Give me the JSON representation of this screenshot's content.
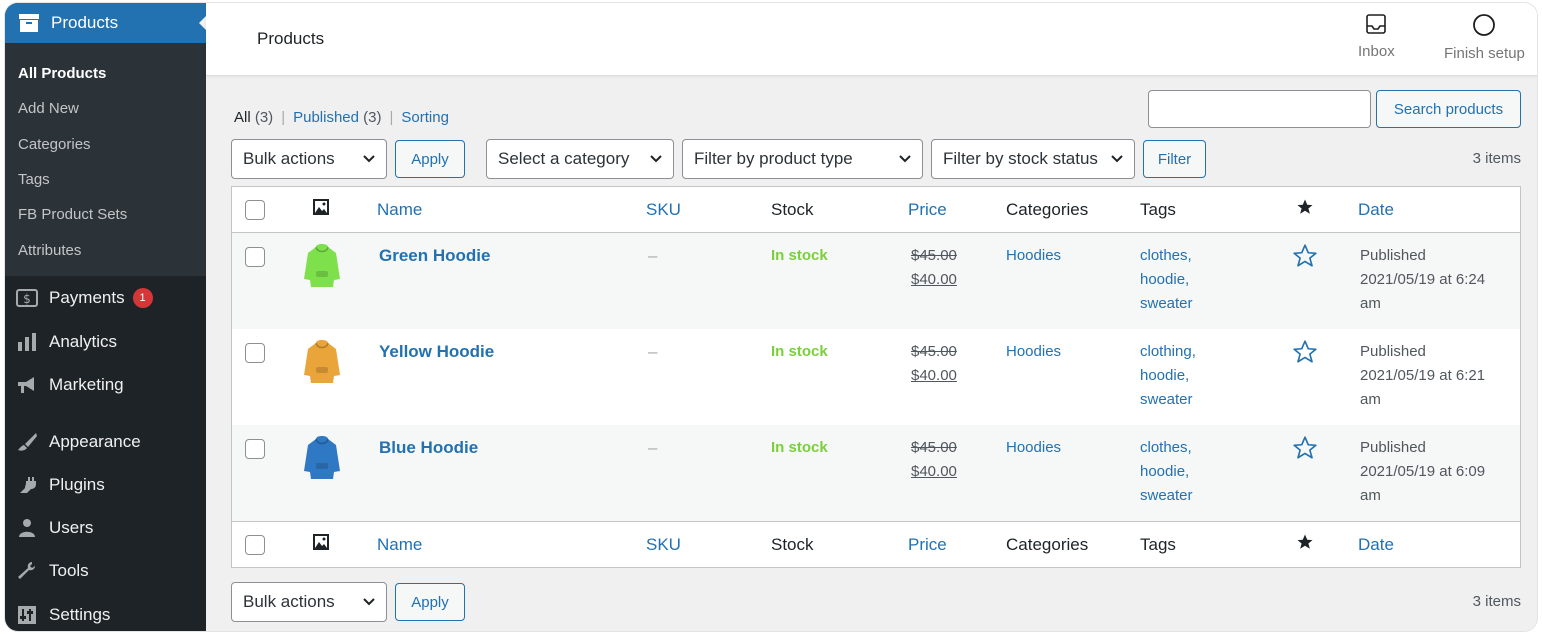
{
  "sidebar": {
    "active": {
      "label": "Products",
      "icon": "archive-icon"
    },
    "submenu": [
      {
        "label": "All Products",
        "current": true
      },
      {
        "label": "Add New"
      },
      {
        "label": "Categories"
      },
      {
        "label": "Tags"
      },
      {
        "label": "FB Product Sets"
      },
      {
        "label": "Attributes"
      }
    ],
    "menu": [
      {
        "label": "Payments",
        "icon": "dollar-icon",
        "badge": "1"
      },
      {
        "label": "Analytics",
        "icon": "bar-chart-icon"
      },
      {
        "label": "Marketing",
        "icon": "megaphone-icon"
      },
      {
        "label": "Appearance",
        "icon": "brush-icon"
      },
      {
        "label": "Plugins",
        "icon": "plug-icon"
      },
      {
        "label": "Users",
        "icon": "user-icon"
      },
      {
        "label": "Tools",
        "icon": "wrench-icon"
      },
      {
        "label": "Settings",
        "icon": "settings-icon"
      }
    ]
  },
  "header": {
    "title": "Products",
    "inbox_label": "Inbox",
    "finish_setup_label": "Finish setup"
  },
  "views": {
    "all": "All",
    "all_count": "(3)",
    "published": "Published",
    "published_count": "(3)",
    "sorting": "Sorting"
  },
  "search": {
    "value": "",
    "button": "Search products"
  },
  "filters": {
    "bulk_actions": "Bulk actions",
    "apply": "Apply",
    "category": "Select a category",
    "product_type": "Filter by product type",
    "stock_status": "Filter by stock status",
    "filter_button": "Filter",
    "items_count": "3 items"
  },
  "table": {
    "columns": {
      "name": "Name",
      "sku": "SKU",
      "stock": "Stock",
      "price": "Price",
      "categories": "Categories",
      "tags": "Tags",
      "date": "Date"
    },
    "rows": [
      {
        "name": "Green Hoodie",
        "sku": "–",
        "stock": "In stock",
        "old_price": "$45.00",
        "price": "$40.00",
        "category": "Hoodies",
        "tags": [
          "clothes,",
          "hoodie,",
          "sweater"
        ],
        "date_status": "Published",
        "date_line1": "2021/05/19 at 6:24",
        "date_line2": "am",
        "color": "#7ee04a"
      },
      {
        "name": "Yellow Hoodie",
        "sku": "–",
        "stock": "In stock",
        "old_price": "$45.00",
        "price": "$40.00",
        "category": "Hoodies",
        "tags": [
          "clothing,",
          "hoodie,",
          "sweater"
        ],
        "date_status": "Published",
        "date_line1": "2021/05/19 at 6:21",
        "date_line2": "am",
        "color": "#e9a43a"
      },
      {
        "name": "Blue Hoodie",
        "sku": "–",
        "stock": "In stock",
        "old_price": "$45.00",
        "price": "$40.00",
        "category": "Hoodies",
        "tags": [
          "clothes,",
          "hoodie,",
          "sweater"
        ],
        "date_status": "Published",
        "date_line1": "2021/05/19 at 6:09",
        "date_line2": "am",
        "color": "#2f78c4"
      }
    ]
  },
  "colors": {
    "accent": "#2271b1",
    "sidebar": "#1d2327",
    "in_stock": "#7ad03a",
    "badge": "#d63638"
  }
}
